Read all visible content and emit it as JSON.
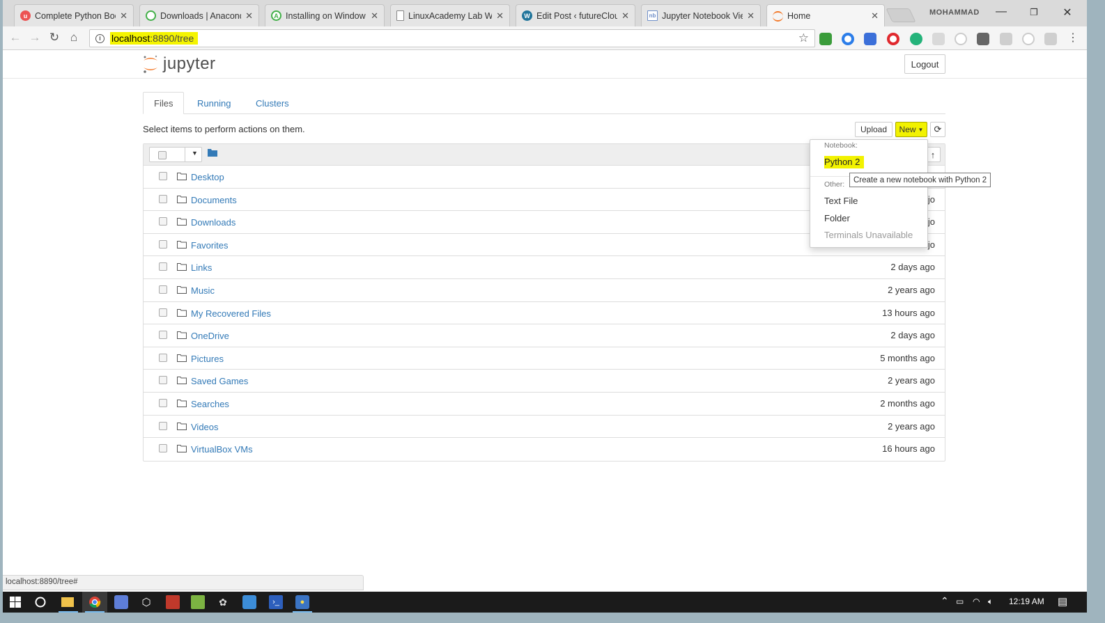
{
  "browser": {
    "tabs": [
      {
        "label": "Complete Python Boo",
        "icon": "udemy-icon",
        "color": "#ec5252"
      },
      {
        "label": "Downloads | Anacond",
        "icon": "anaconda-icon",
        "color": "#43b049"
      },
      {
        "label": "Installing on Window",
        "icon": "atlassian-icon",
        "color": "#43b049"
      },
      {
        "label": "LinuxAcademy Lab W",
        "icon": "page-icon",
        "color": "#888888"
      },
      {
        "label": "Edit Post ‹ futureClou",
        "icon": "wordpress-icon",
        "color": "#21759b"
      },
      {
        "label": "Jupyter Notebook Vie",
        "icon": "notebook-icon",
        "color": "#6f8fc9"
      },
      {
        "label": "Home",
        "icon": "jupyter-icon",
        "color": "#f37726"
      }
    ],
    "username": "MOHAMMAD",
    "url_host": "localhost",
    "url_rest": ":8890/tree",
    "status_url": "localhost:8890/tree#"
  },
  "jupyter": {
    "logo_text": "jupyter",
    "logout_label": "Logout",
    "tabs": [
      "Files",
      "Running",
      "Clusters"
    ],
    "hint": "Select items to perform actions on them.",
    "upload_label": "Upload",
    "new_label": "New",
    "files": [
      {
        "name": "Desktop",
        "modified": ""
      },
      {
        "name": "Documents",
        "modified": ""
      },
      {
        "name": "Downloads",
        "modified": ""
      },
      {
        "name": "Favorites",
        "modified": ""
      },
      {
        "name": "Links",
        "modified": "2 days ago"
      },
      {
        "name": "Music",
        "modified": "2 years ago"
      },
      {
        "name": "My Recovered Files",
        "modified": "13 hours ago"
      },
      {
        "name": "OneDrive",
        "modified": "2 days ago"
      },
      {
        "name": "Pictures",
        "modified": "5 months ago"
      },
      {
        "name": "Saved Games",
        "modified": "2 years ago"
      },
      {
        "name": "Searches",
        "modified": "2 months ago"
      },
      {
        "name": "Videos",
        "modified": "2 years ago"
      },
      {
        "name": "VirtualBox VMs",
        "modified": "16 hours ago"
      }
    ],
    "partial_modified": "jo",
    "menu": {
      "notebook_header": "Notebook:",
      "python2": "Python 2",
      "other_header": "Other:",
      "text_file": "Text File",
      "folder": "Folder",
      "terminals": "Terminals Unavailable",
      "tooltip": "Create a new notebook with Python 2"
    }
  },
  "taskbar": {
    "time": "12:19 AM"
  },
  "colors": {
    "highlight": "#f2f200",
    "link": "#337ab7",
    "jupyter_orange": "#f37726"
  }
}
